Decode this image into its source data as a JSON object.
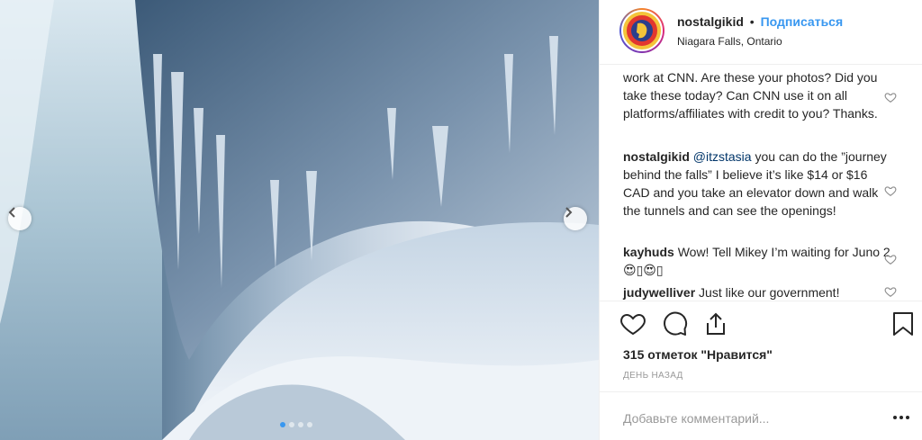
{
  "post": {
    "photo_alt": "",
    "carousel": {
      "dot_count": 4,
      "active_index": 0
    }
  },
  "header": {
    "username": "nostalgikid",
    "separator": "•",
    "follow_label": "Подписаться",
    "location": "Niagara Falls, Ontario"
  },
  "comments": [
    {
      "author": "",
      "mention": "",
      "text": "work at CNN. Are these your photos? Did you take these today? Can CNN use it on all platforms/affiliates with credit to you? Thanks."
    },
    {
      "author": "nostalgikid",
      "mention": "@itzstasia",
      "text": " you can do the ”journey behind the falls” I believe it’s like $14 or $16 CAD and you take an elevator down and walk the tunnels and can see the openings!"
    },
    {
      "author": "kayhuds",
      "mention": "",
      "text": " Wow! Tell Mikey I’m waiting for Juno 2 😍▯😍▯"
    },
    {
      "author": "judywelliver",
      "mention": "",
      "text": " Just like our government!"
    }
  ],
  "stats": {
    "likes": "315 отметок \"Нравится\"",
    "timestamp": "День назад"
  },
  "composer": {
    "placeholder": "Добавьте комментарий..."
  },
  "colors": {
    "accent": "#3897f0",
    "text": "#262626",
    "muted": "#999999",
    "border": "#efefef"
  },
  "icons": {
    "like": "heart-icon",
    "comment": "comment-icon",
    "share": "share-icon",
    "save": "bookmark-icon",
    "prev": "chevron-left-icon",
    "next": "chevron-right-icon",
    "more": "more-icon"
  }
}
